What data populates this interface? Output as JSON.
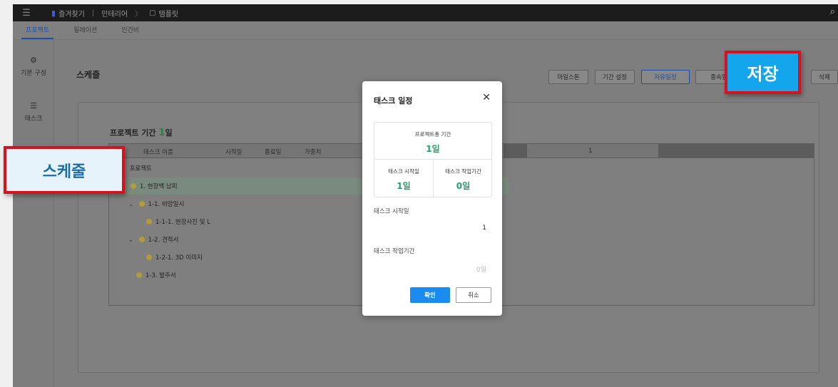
{
  "topbar": {
    "bookmark": "즐겨찾기",
    "crumb1": "인테리어",
    "crumb_arrow": "〉",
    "crumb2": "템플릿"
  },
  "tabs": [
    "프로젝트",
    "릴레이션",
    "인건비"
  ],
  "sidenav": [
    {
      "label": "기본 구성",
      "icon": "gear-icon"
    },
    {
      "label": "태스크",
      "icon": "list-icon"
    }
  ],
  "page_title": "스케줄",
  "header_buttons": [
    "마일스톤",
    "기간 설정",
    "자유일정",
    "종속일",
    "삭제"
  ],
  "project_period": {
    "label": "프로젝트 기간",
    "value": "1",
    "unit": "일"
  },
  "grid": {
    "columns": [
      "태스크 이름",
      "시작일",
      "종료일",
      "가중치"
    ],
    "timeline_label": "1",
    "rows": [
      {
        "label": "프로젝트"
      },
      {
        "label": "1. 현장백 남피"
      },
      {
        "label": "1-1. 비망일시"
      },
      {
        "label": "1-1-1. 현장사진 및 L"
      },
      {
        "label": "1-2. 견적서"
      },
      {
        "label": "1-2-1. 3D 이미지"
      },
      {
        "label": "1-3. 발주서"
      }
    ]
  },
  "modal": {
    "title": "태스크 일정",
    "total_label": "프로젝트총 기간",
    "total_value": "1일",
    "start_label": "태스크 시작일",
    "start_value": "1일",
    "duration_label": "태스크 작업기간",
    "duration_value": "0일",
    "field_start_label": "태스크 시작일",
    "field_start_value": "1",
    "field_duration_label": "태스크 작업기간",
    "field_duration_placeholder": "0일",
    "ok_label": "확인",
    "cancel_label": "취소"
  },
  "callouts": {
    "save": "저장",
    "schedule": "스케줄"
  },
  "colors": {
    "accent": "#1a8cf0",
    "green": "#1fa36b",
    "callout_border": "#d6121c",
    "callout_blue": "#14a6ed"
  }
}
